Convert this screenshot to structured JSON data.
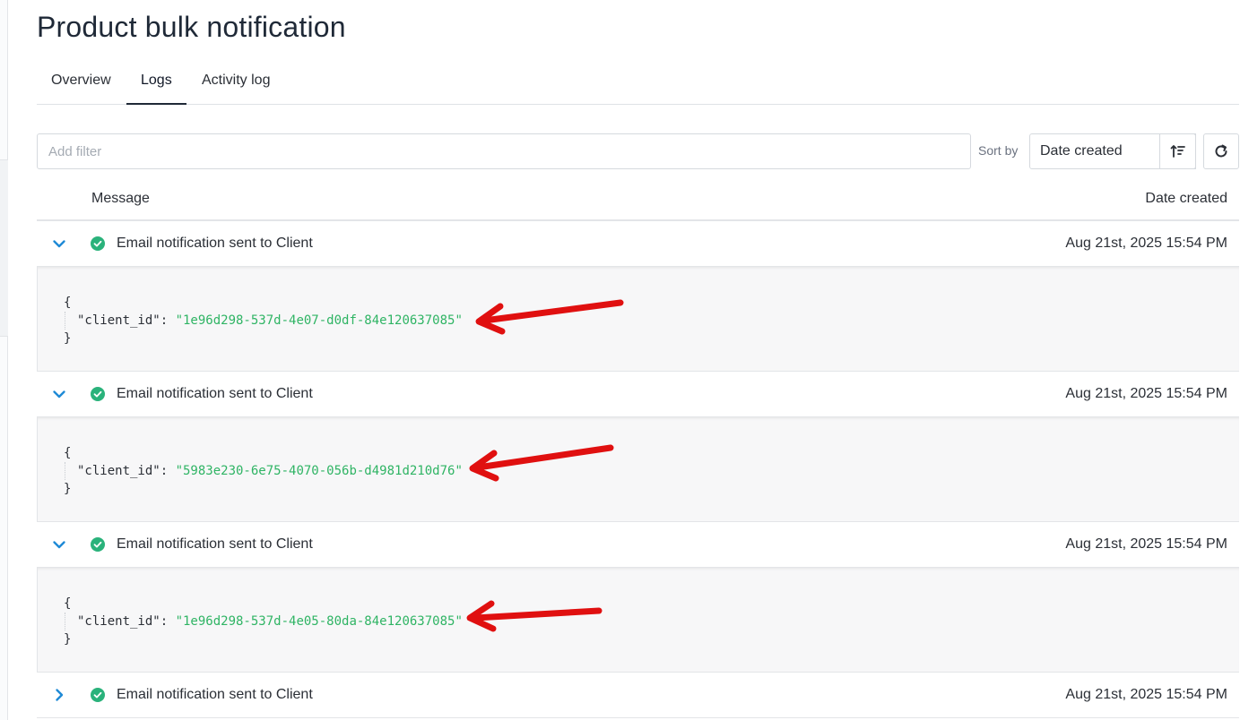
{
  "page": {
    "title": "Product bulk notification"
  },
  "tabs": [
    {
      "label": "Overview",
      "active": false
    },
    {
      "label": "Logs",
      "active": true
    },
    {
      "label": "Activity log",
      "active": false
    }
  ],
  "toolbar": {
    "filter_placeholder": "Add filter",
    "sort_label": "Sort by",
    "sort_value": "Date created"
  },
  "table": {
    "columns": [
      "Message",
      "Date created"
    ],
    "rows": [
      {
        "status": "success",
        "message": "Email notification sent to Client",
        "date": "Aug 21st, 2025 15:54 PM",
        "expanded": true,
        "json_open": "{",
        "json_key": "\"client_id\"",
        "json_sep": ": ",
        "json_value": "\"1e96d298-537d-4e07-d0df-84e120637085\"",
        "json_close": "}"
      },
      {
        "status": "success",
        "message": "Email notification sent to Client",
        "date": "Aug 21st, 2025 15:54 PM",
        "expanded": true,
        "json_open": "{",
        "json_key": "\"client_id\"",
        "json_sep": ": ",
        "json_value": "\"5983e230-6e75-4070-056b-d4981d210d76\"",
        "json_close": "}"
      },
      {
        "status": "success",
        "message": "Email notification sent to Client",
        "date": "Aug 21st, 2025 15:54 PM",
        "expanded": true,
        "json_open": "{",
        "json_key": "\"client_id\"",
        "json_sep": ": ",
        "json_value": "\"1e96d298-537d-4e05-80da-84e120637085\"",
        "json_close": "}"
      },
      {
        "status": "success",
        "message": "Email notification sent to Client",
        "date": "Aug 21st, 2025 15:54 PM",
        "expanded": false
      }
    ]
  },
  "colors": {
    "accent": "#1f8ad6",
    "success": "#2ab27b",
    "json_value": "#2fb464",
    "annotation_arrow": "#e01010"
  },
  "icons": {
    "expand_open": "chevron-down-icon",
    "expand_closed": "chevron-right-icon",
    "status": "check-circle-icon",
    "sort_direction": "sort-ascending-icon",
    "refresh": "refresh-icon",
    "dropdown": "chevron-down-icon"
  }
}
